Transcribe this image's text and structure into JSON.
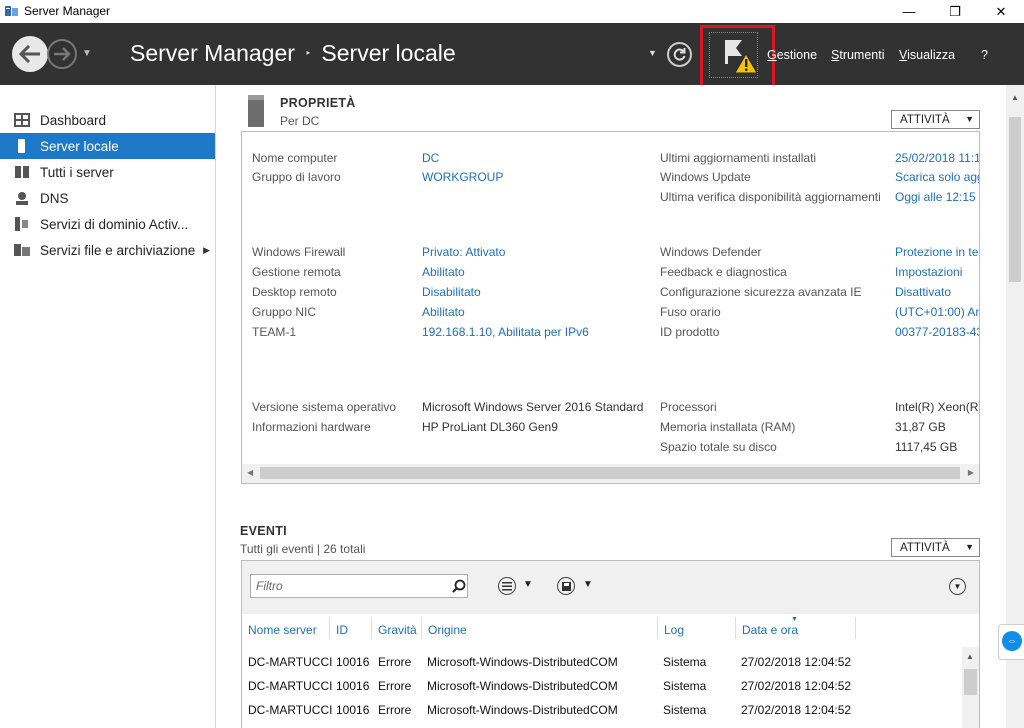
{
  "window": {
    "title": "Server Manager",
    "minimize_glyph": "—",
    "maximize_glyph": "❐",
    "close_glyph": "✕"
  },
  "header": {
    "breadcrumb_root": "Server Manager",
    "breadcrumb_sep": "‣",
    "breadcrumb_current": "Server locale",
    "menu": {
      "gestione": "Gestione",
      "strumenti": "Strumenti",
      "visualizza": "Visualizza",
      "help": "?"
    },
    "notification_icon": "flag-warning-icon"
  },
  "sidebar": {
    "items": [
      {
        "label": "Dashboard",
        "icon": "dashboard-icon"
      },
      {
        "label": "Server locale",
        "icon": "server-icon",
        "active": true
      },
      {
        "label": "Tutti i server",
        "icon": "servers-icon"
      },
      {
        "label": "DNS",
        "icon": "dns-icon"
      },
      {
        "label": "Servizi di dominio Activ...",
        "icon": "ad-icon"
      },
      {
        "label": "Servizi file e archiviazione",
        "icon": "file-storage-icon",
        "has_submenu": true
      }
    ]
  },
  "properties": {
    "title": "PROPRIETÀ",
    "subtitle": "Per DC",
    "task_button": "ATTIVITÀ",
    "left": [
      {
        "label": "Nome computer",
        "value": "DC",
        "link": true
      },
      {
        "label": "Gruppo di lavoro",
        "value": "WORKGROUP",
        "link": true
      },
      {
        "label": "Windows Firewall",
        "value": "Privato: Attivato",
        "link": true
      },
      {
        "label": "Gestione remota",
        "value": "Abilitato",
        "link": true
      },
      {
        "label": "Desktop remoto",
        "value": "Disabilitato",
        "link": true
      },
      {
        "label": "Gruppo NIC",
        "value": "Abilitato",
        "link": true
      },
      {
        "label": "TEAM-1",
        "value": "192.168.1.10, Abilitata per IPv6",
        "link": true
      },
      {
        "label": "Versione sistema operativo",
        "value": "Microsoft Windows Server 2016 Standard",
        "link": false
      },
      {
        "label": "Informazioni hardware",
        "value": "HP ProLiant DL360 Gen9",
        "link": false
      }
    ],
    "right": [
      {
        "label": "Ultimi aggiornamenti installati",
        "value": "25/02/2018 11:1",
        "link": true
      },
      {
        "label": "Windows Update",
        "value": "Scarica solo agg",
        "link": true
      },
      {
        "label": "Ultima verifica disponibilità aggiornamenti",
        "value": "Oggi alle 12:15",
        "link": true
      },
      {
        "label": "Windows Defender",
        "value": "Protezione in te",
        "link": true
      },
      {
        "label": "Feedback e diagnostica",
        "value": "Impostazioni",
        "link": true
      },
      {
        "label": "Configurazione sicurezza avanzata IE",
        "value": "Disattivato",
        "link": true
      },
      {
        "label": "Fuso orario",
        "value": "(UTC+01:00) Am",
        "link": true
      },
      {
        "label": "ID prodotto",
        "value": "00377-20183-43",
        "link": true
      },
      {
        "label": "Processori",
        "value": "Intel(R) Xeon(R)",
        "link": false
      },
      {
        "label": "Memoria installata (RAM)",
        "value": "31,87 GB",
        "link": false
      },
      {
        "label": "Spazio totale su disco",
        "value": "1117,45 GB",
        "link": false
      }
    ]
  },
  "events": {
    "title": "EVENTI",
    "subtitle": "Tutti gli eventi | 26 totali",
    "task_button": "ATTIVITÀ",
    "filter_placeholder": "Filtro",
    "columns": [
      "Nome server",
      "ID",
      "Gravità",
      "Origine",
      "Log",
      "Data e ora"
    ],
    "rows": [
      [
        "DC-MARTUCCI",
        "10016",
        "Errore",
        "Microsoft-Windows-DistributedCOM",
        "Sistema",
        "27/02/2018 12:04:52"
      ],
      [
        "DC-MARTUCCI",
        "10016",
        "Errore",
        "Microsoft-Windows-DistributedCOM",
        "Sistema",
        "27/02/2018 12:04:52"
      ],
      [
        "DC-MARTUCCI",
        "10016",
        "Errore",
        "Microsoft-Windows-DistributedCOM",
        "Sistema",
        "27/02/2018 12:04:52"
      ]
    ]
  },
  "colors": {
    "header_bg": "#323232",
    "active_item": "#1e78c8",
    "link": "#1f6fba",
    "highlight": "#e0141e",
    "warning": "#f5c400"
  }
}
